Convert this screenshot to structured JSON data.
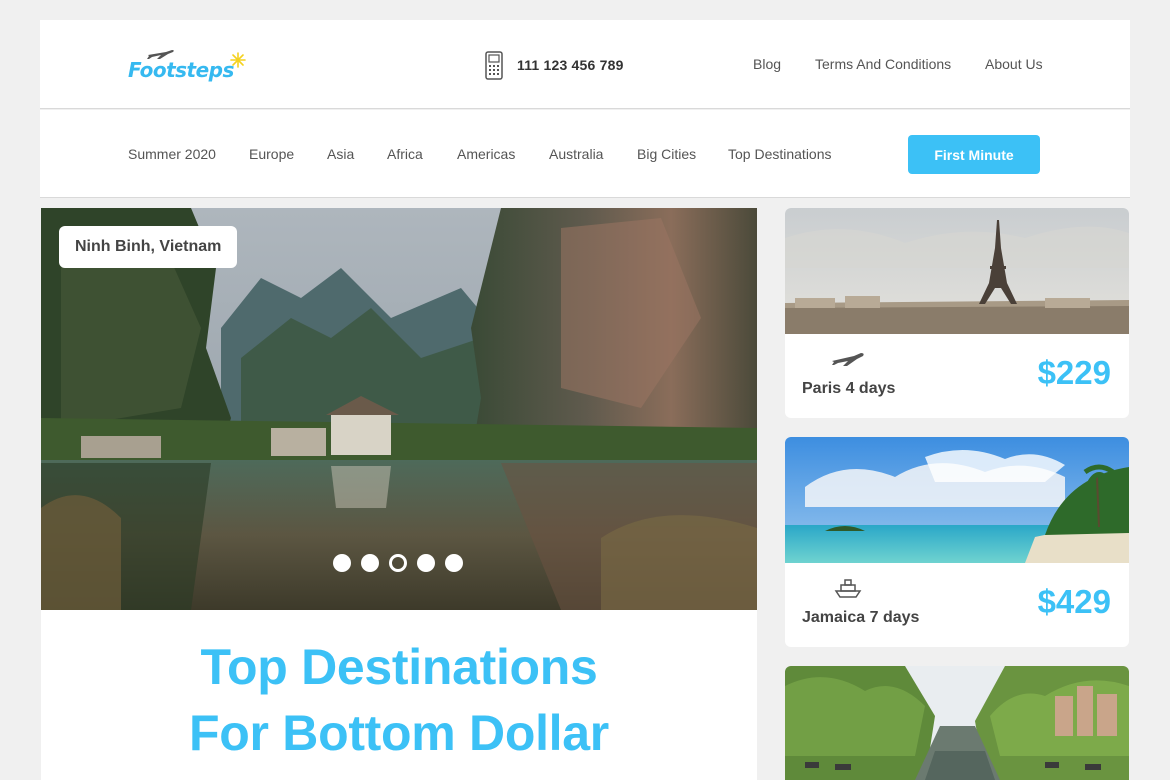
{
  "brand": {
    "name": "Footsteps"
  },
  "header": {
    "phone": "111 123 456 789",
    "links": [
      "Blog",
      "Terms And Conditions",
      "About Us"
    ]
  },
  "nav": {
    "items": [
      "Summer 2020",
      "Europe",
      "Asia",
      "Africa",
      "Americas",
      "Australia",
      "Big Cities",
      "Top Destinations"
    ],
    "cta": "First Minute"
  },
  "hero": {
    "location": "Ninh Binh, Vietnam",
    "slides": 5,
    "active_slide": 3
  },
  "headline": {
    "line1": "Top Destinations",
    "line2": "For Bottom Dollar"
  },
  "deals": [
    {
      "title": "Paris 4 days",
      "price": "$229",
      "icon": "plane-icon"
    },
    {
      "title": "Jamaica 7 days",
      "price": "$429",
      "icon": "ship-icon"
    }
  ],
  "colors": {
    "accent": "#3cc1f6",
    "background": "#f0f0f0"
  }
}
